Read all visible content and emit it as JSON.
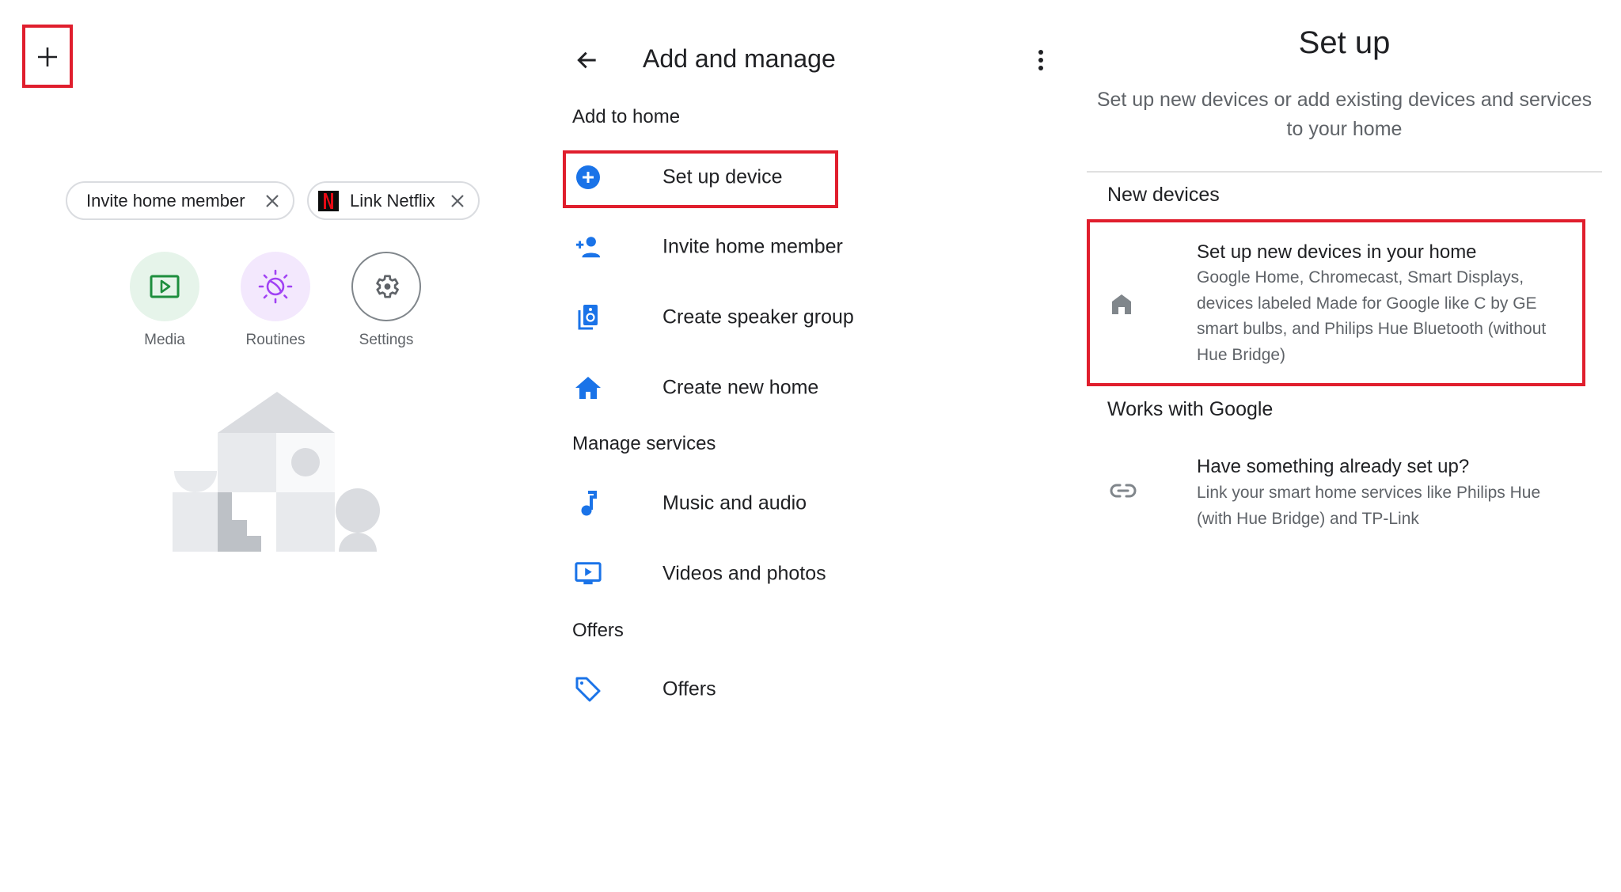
{
  "colors": {
    "highlight": "#e01e2d",
    "accent_blue": "#1a73e8",
    "text_primary": "#202124",
    "text_secondary": "#5f6368"
  },
  "home_panel": {
    "add_icon": "plus-icon",
    "chips": [
      {
        "label": "Invite home member",
        "dismiss_icon": "close-icon"
      },
      {
        "label": "Link Netflix",
        "logo": "N",
        "dismiss_icon": "close-icon"
      }
    ],
    "shortcuts": [
      {
        "label": "Media",
        "icon": "media-play-icon"
      },
      {
        "label": "Routines",
        "icon": "routines-sun-moon-icon"
      },
      {
        "label": "Settings",
        "icon": "gear-icon"
      }
    ]
  },
  "add_manage_panel": {
    "title": "Add and manage",
    "sections": [
      {
        "header": "Add to home",
        "items": [
          {
            "label": "Set up device",
            "icon": "add-circle-icon"
          },
          {
            "label": "Invite home member",
            "icon": "person-add-icon"
          },
          {
            "label": "Create speaker group",
            "icon": "speaker-group-icon"
          },
          {
            "label": "Create new home",
            "icon": "home-icon"
          }
        ]
      },
      {
        "header": "Manage services",
        "items": [
          {
            "label": "Music and audio",
            "icon": "music-note-icon"
          },
          {
            "label": "Videos and photos",
            "icon": "video-icon"
          }
        ]
      },
      {
        "header": "Offers",
        "items": [
          {
            "label": "Offers",
            "icon": "tag-icon"
          }
        ]
      }
    ]
  },
  "setup_panel": {
    "title": "Set up",
    "subtitle": "Set up new devices or add existing devices and services to your home",
    "sections": [
      {
        "header": "New devices",
        "card": {
          "title": "Set up new devices in your home",
          "description": "Google Home, Chromecast, Smart Displays, devices labeled Made for Google like C by GE smart bulbs, and Philips Hue Bluetooth (without Hue Bridge)",
          "icon": "home-icon"
        }
      },
      {
        "header": "Works with Google",
        "card": {
          "title": "Have something already set up?",
          "description": "Link your smart home services like Philips Hue (with Hue Bridge) and TP-Link",
          "icon": "link-icon"
        }
      }
    ]
  }
}
